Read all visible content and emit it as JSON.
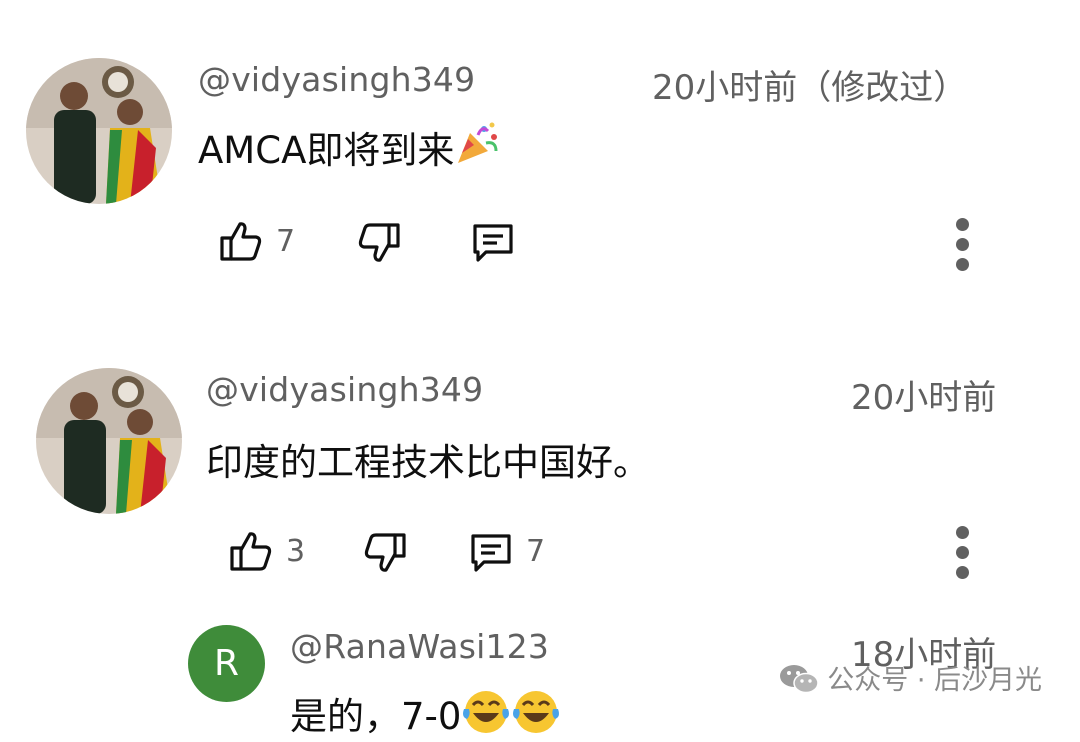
{
  "comments": [
    {
      "handle": "@vidyasingh349",
      "time": "20小时前（修改过）",
      "text": "AMCA即将到来",
      "text_emoji": "party-popper",
      "likes": "7",
      "replies": ""
    },
    {
      "handle": "@vidyasingh349",
      "time": "20小时前",
      "text": "印度的工程技术比中国好。",
      "likes": "3",
      "replies": "7"
    }
  ],
  "reply": {
    "avatar_letter": "R",
    "handle": "@RanaWasi123",
    "time": "18小时前",
    "text": "是的，7-0",
    "text_emoji": "face-with-tears-of-joy x2"
  },
  "watermark": {
    "icon": "wechat-icon",
    "text": "公众号 · 后沙月光"
  },
  "colors": {
    "secondary_text": "#606060",
    "primary_text": "#0f0f0f",
    "reply_avatar_bg": "#3f8c3a"
  }
}
